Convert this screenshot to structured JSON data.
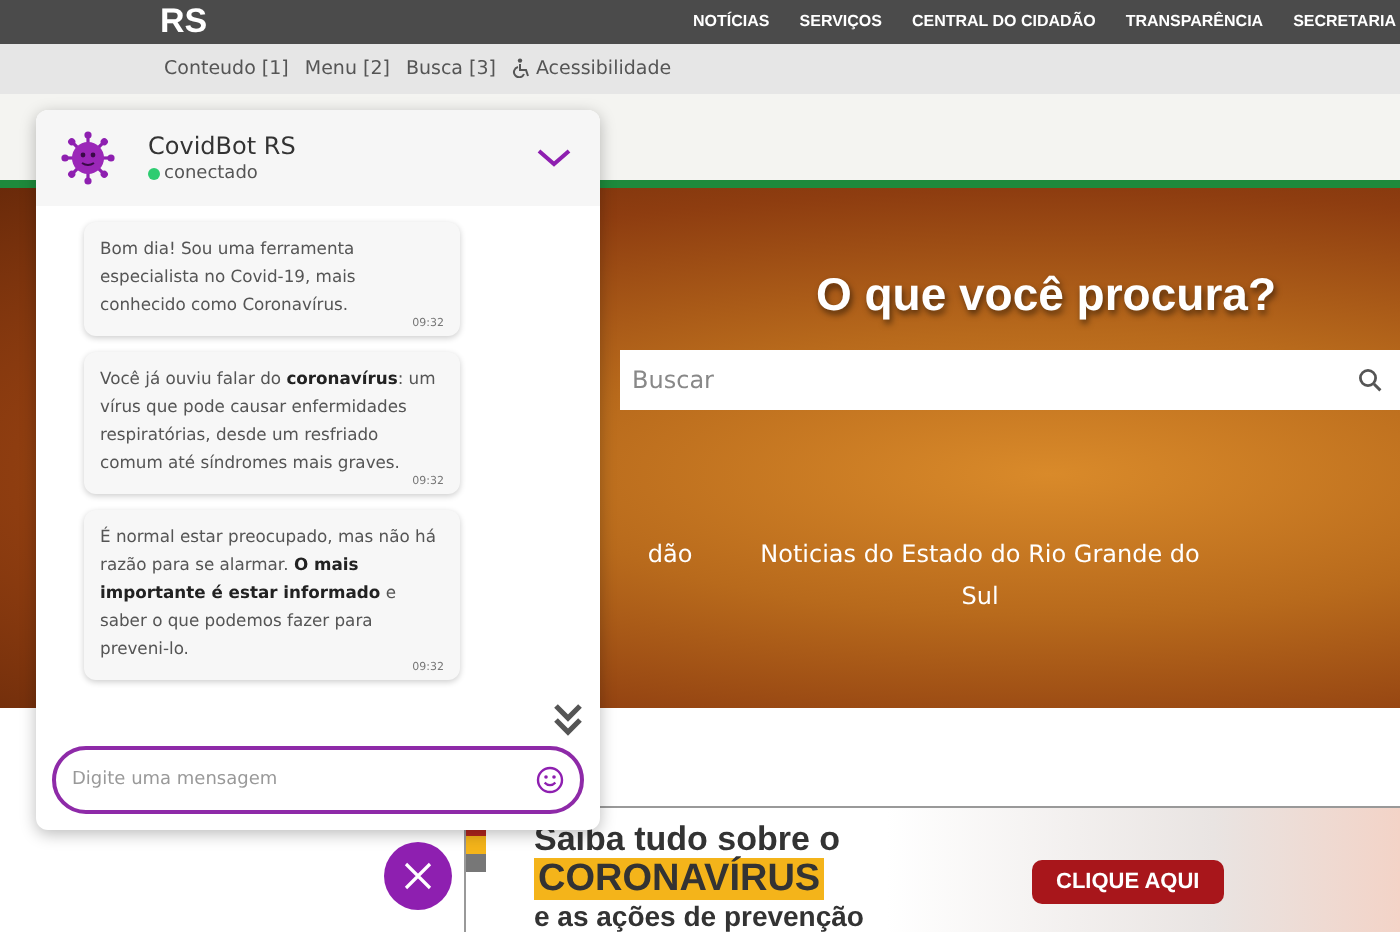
{
  "header": {
    "logo": "RS",
    "nav": [
      "NOTÍCIAS",
      "SERVIÇOS",
      "CENTRAL DO CIDADÃO",
      "TRANSPARÊNCIA",
      "SECRETARIA"
    ]
  },
  "skip_links": [
    {
      "label": "Conteudo [1]",
      "kind": "text"
    },
    {
      "label": "Menu [2]",
      "kind": "text"
    },
    {
      "label": "Busca [3]",
      "kind": "text"
    },
    {
      "label": "Acessibilidade",
      "kind": "accessibility"
    }
  ],
  "hero": {
    "heading": "O que você procura?",
    "search": {
      "placeholder": "Buscar"
    },
    "links": [
      "dão",
      "Noticias do Estado do Rio Grande do Sul"
    ]
  },
  "banner": {
    "line_1": "Saiba tudo sobre o",
    "highlight": "CORONAVÍRUS",
    "line_3": "e as ações de prevenção",
    "button": "CLIQUE AQUI"
  },
  "chat": {
    "title": "CovidBot RS",
    "status": "conectado",
    "online": true,
    "messages": [
      {
        "text": "Bom dia! Sou uma ferramenta especialista no Covid-19, mais conhecido como Coronavírus.",
        "time": "09:32"
      },
      {
        "text": "Você já ouviu falar do **coronavírus**: um vírus que pode causar enfermidades respiratórias, desde um resfriado comum até síndromes mais graves.",
        "time": "09:32"
      },
      {
        "text": "É normal estar preocupado, mas não há razão para se alarmar. **O mais importante é estar informado** e saber o que podemos fazer para preveni-lo.",
        "time": "09:32"
      }
    ],
    "input": {
      "placeholder": "Digite uma mensagem"
    }
  }
}
